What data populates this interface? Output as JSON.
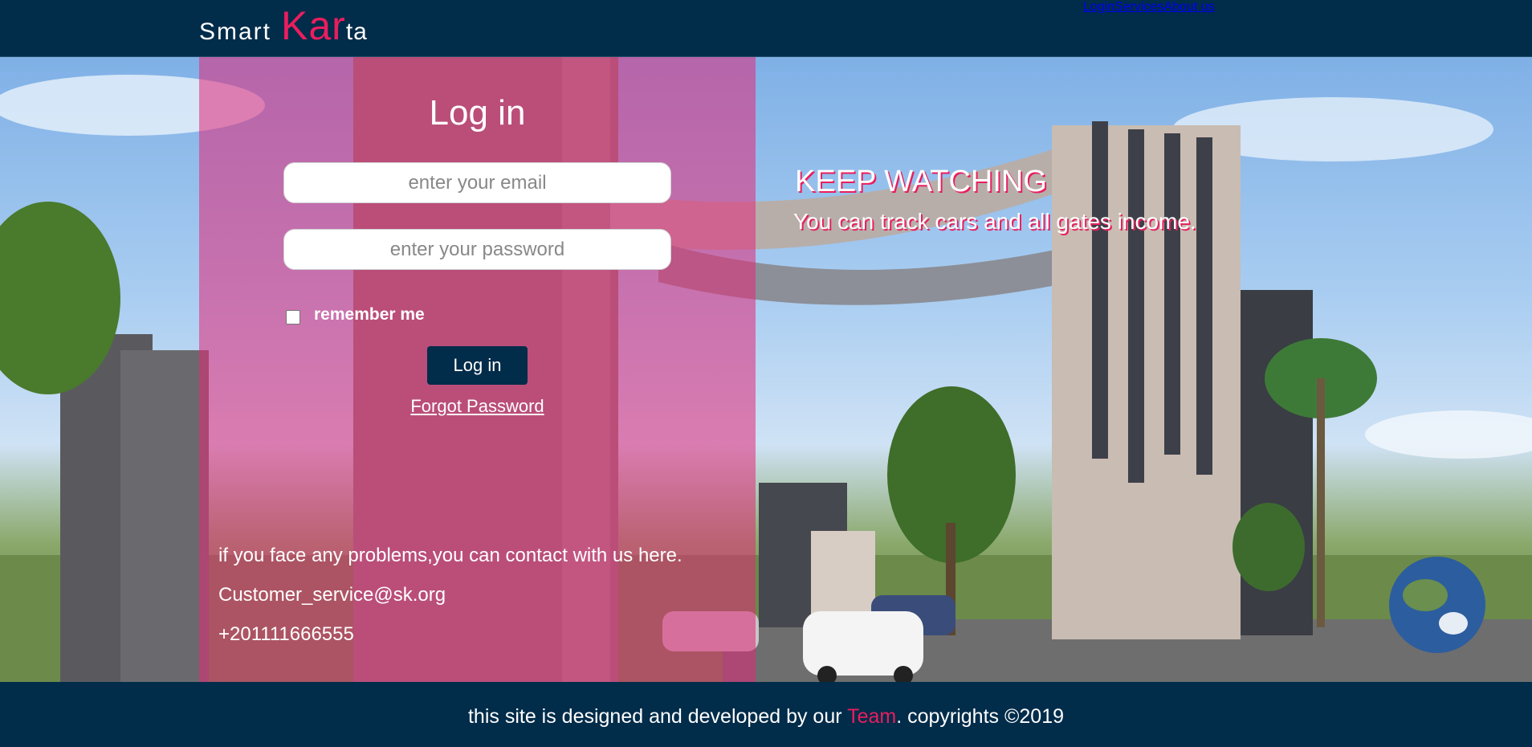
{
  "brand": {
    "part1": "Smart",
    "part2": "Kar",
    "part3": "ta",
    "accent_color": "#e91e5e"
  },
  "nav": {
    "items": [
      {
        "label": "Login"
      },
      {
        "label": "Services"
      },
      {
        "label": "About us"
      }
    ],
    "active": "Login"
  },
  "login": {
    "title": "Log in",
    "email_placeholder": "enter your email",
    "password_placeholder": "enter your password",
    "remember_label": "remember me",
    "remember_checked": false,
    "button_label": "Log in",
    "forgot_label": "Forgot Password"
  },
  "contact": {
    "line1": "if you face any problems,you can contact with us here.",
    "email": "Customer_service@sk.org",
    "phone": "+201111666555"
  },
  "hero": {
    "heading": "KEEP WATCHING",
    "subheading": "You can track cars and all gates income."
  },
  "footer": {
    "prefix": "this site is designed and developed by our ",
    "link": "Team",
    "suffix": ". copyrights ©2019"
  },
  "colors": {
    "navy": "#012c4a",
    "pink": "#e91e5e"
  }
}
